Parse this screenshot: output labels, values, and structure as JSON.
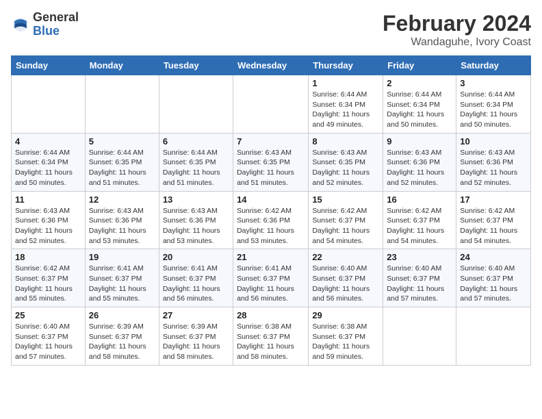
{
  "header": {
    "logo_general": "General",
    "logo_blue": "Blue",
    "title": "February 2024",
    "subtitle": "Wandaguhe, Ivory Coast"
  },
  "columns": [
    "Sunday",
    "Monday",
    "Tuesday",
    "Wednesday",
    "Thursday",
    "Friday",
    "Saturday"
  ],
  "weeks": [
    [
      {
        "day": "",
        "info": ""
      },
      {
        "day": "",
        "info": ""
      },
      {
        "day": "",
        "info": ""
      },
      {
        "day": "",
        "info": ""
      },
      {
        "day": "1",
        "info": "Sunrise: 6:44 AM\nSunset: 6:34 PM\nDaylight: 11 hours and 49 minutes."
      },
      {
        "day": "2",
        "info": "Sunrise: 6:44 AM\nSunset: 6:34 PM\nDaylight: 11 hours and 50 minutes."
      },
      {
        "day": "3",
        "info": "Sunrise: 6:44 AM\nSunset: 6:34 PM\nDaylight: 11 hours and 50 minutes."
      }
    ],
    [
      {
        "day": "4",
        "info": "Sunrise: 6:44 AM\nSunset: 6:34 PM\nDaylight: 11 hours and 50 minutes."
      },
      {
        "day": "5",
        "info": "Sunrise: 6:44 AM\nSunset: 6:35 PM\nDaylight: 11 hours and 51 minutes."
      },
      {
        "day": "6",
        "info": "Sunrise: 6:44 AM\nSunset: 6:35 PM\nDaylight: 11 hours and 51 minutes."
      },
      {
        "day": "7",
        "info": "Sunrise: 6:43 AM\nSunset: 6:35 PM\nDaylight: 11 hours and 51 minutes."
      },
      {
        "day": "8",
        "info": "Sunrise: 6:43 AM\nSunset: 6:35 PM\nDaylight: 11 hours and 52 minutes."
      },
      {
        "day": "9",
        "info": "Sunrise: 6:43 AM\nSunset: 6:36 PM\nDaylight: 11 hours and 52 minutes."
      },
      {
        "day": "10",
        "info": "Sunrise: 6:43 AM\nSunset: 6:36 PM\nDaylight: 11 hours and 52 minutes."
      }
    ],
    [
      {
        "day": "11",
        "info": "Sunrise: 6:43 AM\nSunset: 6:36 PM\nDaylight: 11 hours and 52 minutes."
      },
      {
        "day": "12",
        "info": "Sunrise: 6:43 AM\nSunset: 6:36 PM\nDaylight: 11 hours and 53 minutes."
      },
      {
        "day": "13",
        "info": "Sunrise: 6:43 AM\nSunset: 6:36 PM\nDaylight: 11 hours and 53 minutes."
      },
      {
        "day": "14",
        "info": "Sunrise: 6:42 AM\nSunset: 6:36 PM\nDaylight: 11 hours and 53 minutes."
      },
      {
        "day": "15",
        "info": "Sunrise: 6:42 AM\nSunset: 6:37 PM\nDaylight: 11 hours and 54 minutes."
      },
      {
        "day": "16",
        "info": "Sunrise: 6:42 AM\nSunset: 6:37 PM\nDaylight: 11 hours and 54 minutes."
      },
      {
        "day": "17",
        "info": "Sunrise: 6:42 AM\nSunset: 6:37 PM\nDaylight: 11 hours and 54 minutes."
      }
    ],
    [
      {
        "day": "18",
        "info": "Sunrise: 6:42 AM\nSunset: 6:37 PM\nDaylight: 11 hours and 55 minutes."
      },
      {
        "day": "19",
        "info": "Sunrise: 6:41 AM\nSunset: 6:37 PM\nDaylight: 11 hours and 55 minutes."
      },
      {
        "day": "20",
        "info": "Sunrise: 6:41 AM\nSunset: 6:37 PM\nDaylight: 11 hours and 56 minutes."
      },
      {
        "day": "21",
        "info": "Sunrise: 6:41 AM\nSunset: 6:37 PM\nDaylight: 11 hours and 56 minutes."
      },
      {
        "day": "22",
        "info": "Sunrise: 6:40 AM\nSunset: 6:37 PM\nDaylight: 11 hours and 56 minutes."
      },
      {
        "day": "23",
        "info": "Sunrise: 6:40 AM\nSunset: 6:37 PM\nDaylight: 11 hours and 57 minutes."
      },
      {
        "day": "24",
        "info": "Sunrise: 6:40 AM\nSunset: 6:37 PM\nDaylight: 11 hours and 57 minutes."
      }
    ],
    [
      {
        "day": "25",
        "info": "Sunrise: 6:40 AM\nSunset: 6:37 PM\nDaylight: 11 hours and 57 minutes."
      },
      {
        "day": "26",
        "info": "Sunrise: 6:39 AM\nSunset: 6:37 PM\nDaylight: 11 hours and 58 minutes."
      },
      {
        "day": "27",
        "info": "Sunrise: 6:39 AM\nSunset: 6:37 PM\nDaylight: 11 hours and 58 minutes."
      },
      {
        "day": "28",
        "info": "Sunrise: 6:38 AM\nSunset: 6:37 PM\nDaylight: 11 hours and 58 minutes."
      },
      {
        "day": "29",
        "info": "Sunrise: 6:38 AM\nSunset: 6:37 PM\nDaylight: 11 hours and 59 minutes."
      },
      {
        "day": "",
        "info": ""
      },
      {
        "day": "",
        "info": ""
      }
    ]
  ]
}
